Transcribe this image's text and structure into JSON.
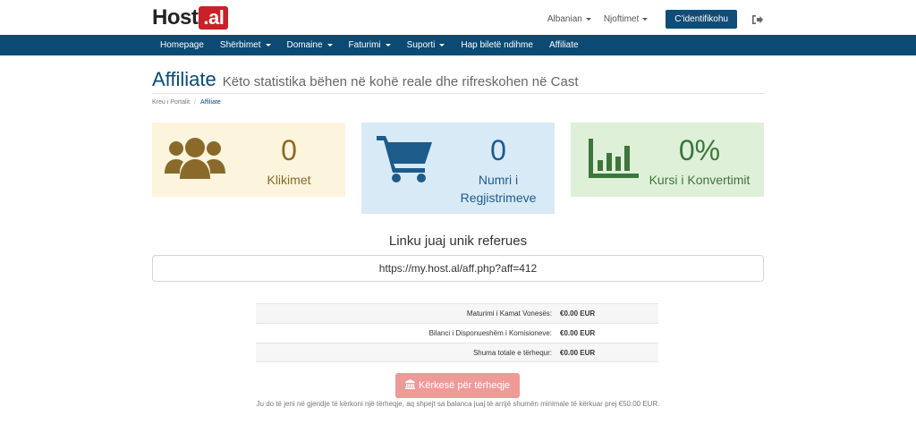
{
  "brand": {
    "prefix": "Host",
    "suffix": ".al"
  },
  "header": {
    "language_label": "Albanian",
    "notifications_label": "Njoftimet",
    "login_label": "C'identifikohu"
  },
  "nav": {
    "items": [
      {
        "label": "Homepage",
        "dropdown": false
      },
      {
        "label": "Shërbimet",
        "dropdown": true
      },
      {
        "label": "Domaine",
        "dropdown": true
      },
      {
        "label": "Faturimi",
        "dropdown": true
      },
      {
        "label": "Suporti",
        "dropdown": true
      },
      {
        "label": "Hap biletë ndihme",
        "dropdown": false
      },
      {
        "label": "Affiliate",
        "dropdown": false
      }
    ]
  },
  "page": {
    "title": "Affiliate",
    "subtitle": "Këto statistika bëhen në kohë reale dhe rifreskohen në Cast"
  },
  "breadcrumb": {
    "home": "Kreu i Portalit",
    "separator": "/",
    "current": "Affiliate"
  },
  "stats": [
    {
      "value": "0",
      "label": "Klikimet",
      "icon": "users-icon",
      "color": "#8a6a2a",
      "bg": "#fcf4dc"
    },
    {
      "value": "0",
      "label": "Numri i Regjistrimeve",
      "icon": "cart-icon",
      "color": "#1c5b8a",
      "bg": "#d8eaf6"
    },
    {
      "value": "0%",
      "label": "Kursi i Konvertimit",
      "icon": "bar-chart-icon",
      "color": "#3c763d",
      "bg": "#dff0d8"
    }
  ],
  "referral": {
    "heading": "Linku juaj unik referues",
    "url": "https://my.host.al/aff.php?aff=412"
  },
  "summary": [
    {
      "label": "Maturimi i Kamat Vonesës:",
      "value": "€0.00 EUR"
    },
    {
      "label": "Bilanci i Disponueshëm i Komisioneve:",
      "value": "€0.00 EUR"
    },
    {
      "label": "Shuma totale e tërhequr:",
      "value": "€0.00 EUR"
    }
  ],
  "withdraw": {
    "label": "Kërkesë për tërheqje",
    "note": "Ju do të jeni në gjendje të kërkoni një tërheqje, aq shpejt sa balanca juaj të arrijë shumën minimale të kërkuar prej €50.00 EUR."
  },
  "colors": {
    "brand_red": "#c82128",
    "primary": "#0b4a74",
    "withdraw_disabled": "#ee9a97"
  }
}
